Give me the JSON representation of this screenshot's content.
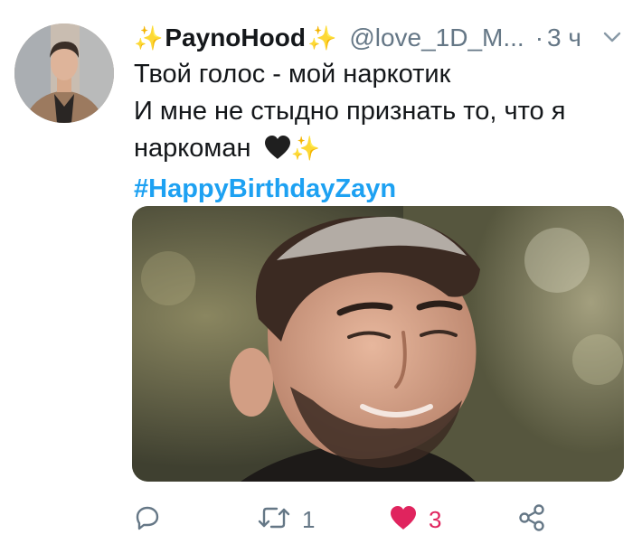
{
  "tweet": {
    "display_name": "PaynoHood",
    "handle": "@love_1D_M...",
    "separator": "·",
    "time": "3 ч",
    "text_lines": [
      "Твой голос - мой наркотик",
      "И мне не стыдно признать то, что я",
      "наркоман"
    ],
    "hashtag": "#HappyBirthdayZayn",
    "media_alt": "Photo of smiling man with beard",
    "reply_count": "",
    "retweet_count": "1",
    "like_count": "3",
    "liked": true
  },
  "icons": {
    "name_left": "sparkles-icon",
    "name_right": "sparkles-icon",
    "menu": "chevron-down-icon",
    "inline_emoji": [
      "black-heart-icon",
      "sparkles-icon"
    ],
    "actions": [
      "reply-icon",
      "retweet-icon",
      "heart-icon",
      "share-icon"
    ]
  },
  "colors": {
    "link": "#1da1f2",
    "like": "#e0245e",
    "muted": "#657786",
    "text": "#14171a",
    "sparkle": "#f5c242"
  }
}
